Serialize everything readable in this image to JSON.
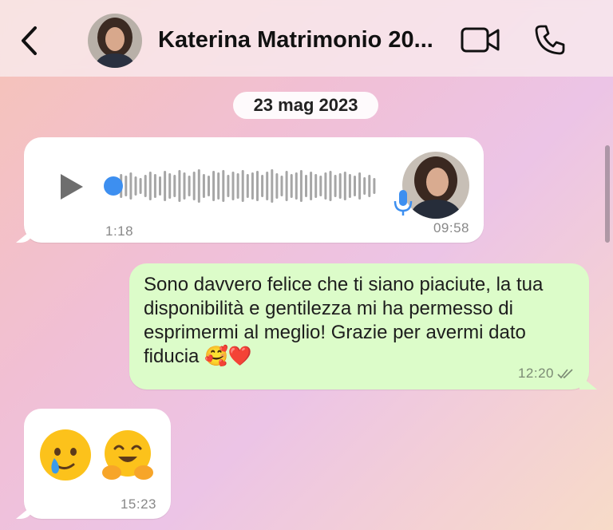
{
  "header": {
    "contact_name": "Katerina Matrimonio 20..."
  },
  "date_divider": "23 mag 2023",
  "messages": [
    {
      "type": "voice",
      "direction": "incoming",
      "duration": "1:18",
      "time": "09:58",
      "playback_progress": 0
    },
    {
      "type": "text",
      "direction": "outgoing",
      "text": "Sono davvero felice che ti siano piaciute, la tua disponibilità e gentilezza mi ha permesso di esprimermi al meglio! Grazie per avermi dato fiducia 🥰❤️",
      "time": "12:20",
      "status": "read"
    },
    {
      "type": "emoji",
      "direction": "incoming",
      "emojis": [
        "face-holding-back-tears",
        "hugging-face"
      ],
      "time": "15:23"
    }
  ],
  "colors": {
    "outgoing_bubble": "#dcfcc9",
    "incoming_bubble": "#ffffff",
    "accent": "#3d8ff0"
  },
  "icons": [
    "back-chevron-icon",
    "video-call-icon",
    "phone-icon",
    "play-icon",
    "microphone-icon",
    "double-check-icon"
  ]
}
